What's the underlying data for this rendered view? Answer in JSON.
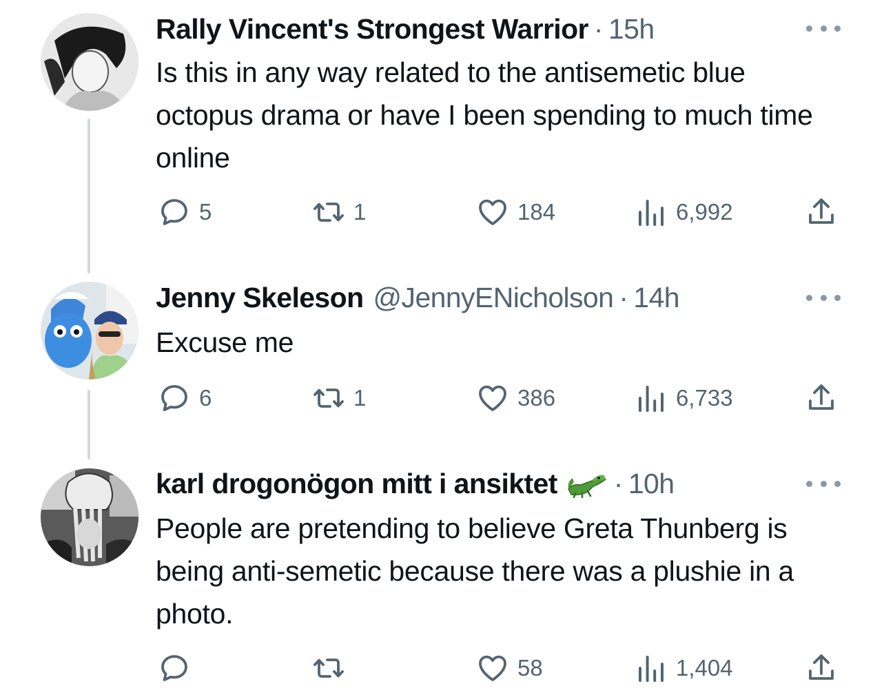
{
  "tweets": [
    {
      "name": "Rally Vincent's Strongest Warrior",
      "handle": "",
      "separator": "·",
      "time": "15h",
      "text": "Is this in any way related to the antisemetic blue octopus drama or have I been spending to much time online",
      "replies": "5",
      "retweets": "1",
      "likes": "184",
      "views": "6,992"
    },
    {
      "name": "Jenny Skeleson",
      "handle": "@JennyENicholson",
      "separator": "·",
      "time": "14h",
      "text": "Excuse me",
      "replies": "6",
      "retweets": "1",
      "likes": "386",
      "views": "6,733"
    },
    {
      "name": "karl drogonögon mitt i ansiktet",
      "handle": "",
      "separator": "·",
      "time": "10h",
      "emoji": "crocodile-emoji",
      "text": "People are pretending to believe Greta Thunberg is being anti-semetic because there was a plushie in a photo.",
      "replies": "",
      "retweets": "",
      "likes": "58",
      "views": "1,404"
    }
  ],
  "icons": {
    "reply": "reply-icon",
    "retweet": "retweet-icon",
    "like": "heart-icon",
    "views": "views-icon",
    "share": "share-icon",
    "more": "more-icon"
  },
  "colors": {
    "text": "#0f1419",
    "muted": "#536471",
    "thread_line": "#cfd9de"
  }
}
